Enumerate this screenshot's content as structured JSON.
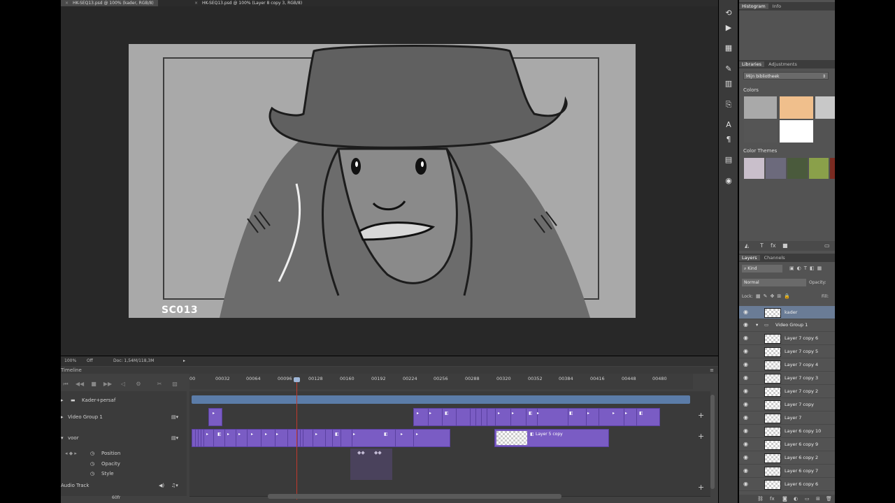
{
  "document_tabs": [
    {
      "label": "HK-SEQ13.psd @ 100% (kader, RGB/8)",
      "active": true
    },
    {
      "label": "HK-SEQ13.psd @ 100% (Layer 8 copy 3, RGB/8)",
      "active": false
    }
  ],
  "canvas": {
    "scene_label": "SC013"
  },
  "statusbar": {
    "zoom": "100%",
    "toggle": "Off",
    "doc": "Doc: 1,54M/118,3M"
  },
  "timeline": {
    "title": "Timeline",
    "ruler_ticks": [
      "00",
      "00032",
      "00064",
      "00096",
      "00128",
      "00160",
      "00192",
      "00224",
      "00256",
      "00288",
      "00320",
      "00352",
      "00384",
      "00416",
      "00448",
      "00480"
    ],
    "tracks": {
      "group1": "Kader+persaf",
      "group2": "Video Group 1",
      "group3": "voor",
      "prop_position": "Position",
      "prop_opacity": "Opacity",
      "prop_style": "Style",
      "audio": "Audio Track"
    },
    "clip_label": "Layer 5 copy",
    "footer_left": "60fr"
  },
  "panels": {
    "histogram_tabs": [
      "Histogram",
      "Info"
    ],
    "libraries_tabs": [
      "Libraries",
      "Adjustments"
    ],
    "library_select": "Mijn bibliotheek",
    "colors_heading": "Colors",
    "color_themes_heading": "Color Themes",
    "colors": [
      "#a9a9a9",
      "#f0bf8c",
      "#c8c8c8",
      "#555555",
      "#ffffff"
    ],
    "themes": [
      "#c9bfcb",
      "#6c6a7c",
      "#4a5a3c",
      "#8aa04a",
      "#7a2a20"
    ],
    "layers_tabs": [
      "Layers",
      "Channels"
    ],
    "kind_label": "Kind",
    "blend_mode": "Normal",
    "opacity_label": "Opacity:",
    "lock_label": "Lock:",
    "fill_label": "Fill:",
    "layers": [
      {
        "name": "kader",
        "indent": 0,
        "selected": true
      },
      {
        "name": "Video Group 1",
        "indent": 0,
        "group": true
      },
      {
        "name": "Layer 7 copy 6",
        "indent": 1
      },
      {
        "name": "Layer 7 copy 5",
        "indent": 1
      },
      {
        "name": "Layer 7 copy 4",
        "indent": 1
      },
      {
        "name": "Layer 7 copy 3",
        "indent": 1
      },
      {
        "name": "Layer 7 copy 2",
        "indent": 1
      },
      {
        "name": "Layer 7 copy",
        "indent": 1
      },
      {
        "name": "Layer 7",
        "indent": 1
      },
      {
        "name": "Layer 6 copy 10",
        "indent": 1
      },
      {
        "name": "Layer 6 copy 9",
        "indent": 1
      },
      {
        "name": "Layer 6 copy 2",
        "indent": 1
      },
      {
        "name": "Layer 6 copy 7",
        "indent": 1
      },
      {
        "name": "Layer 6 copy 6",
        "indent": 1
      }
    ]
  }
}
